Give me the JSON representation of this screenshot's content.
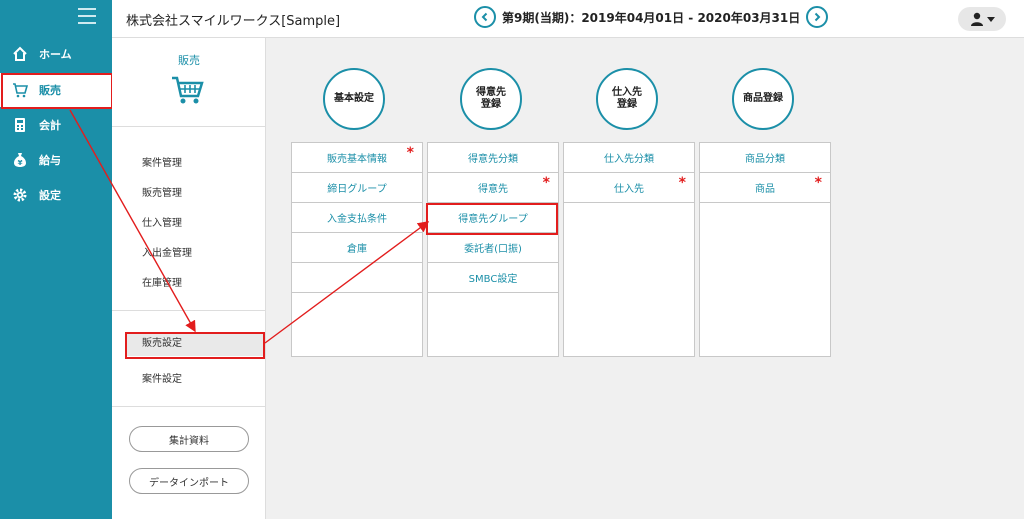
{
  "header": {
    "company": "株式会社スマイルワークス[Sample]",
    "period": "第9期(当期)：2019年04月01日 - 2020年03月31日"
  },
  "nav": {
    "items": [
      {
        "label": "ホーム",
        "icon": "home-icon"
      },
      {
        "label": "販売",
        "icon": "cart-icon"
      },
      {
        "label": "会計",
        "icon": "calculator-icon"
      },
      {
        "label": "給与",
        "icon": "yen-bag-icon"
      },
      {
        "label": "設定",
        "icon": "gear-icon"
      }
    ]
  },
  "subnav": {
    "title": "販売",
    "items": [
      "案件管理",
      "販売管理",
      "仕入管理",
      "入出金管理",
      "在庫管理"
    ],
    "settings": [
      "販売設定",
      "案件設定"
    ],
    "buttons": [
      "集計資料",
      "データインポート"
    ]
  },
  "categories": [
    {
      "title": "基本設定",
      "items": [
        {
          "label": "販売基本情報",
          "required": true
        },
        {
          "label": "締日グループ",
          "required": false
        },
        {
          "label": "入金支払条件",
          "required": false
        },
        {
          "label": "倉庫",
          "required": false
        }
      ]
    },
    {
      "title": "得意先\n登録",
      "items": [
        {
          "label": "得意先分類",
          "required": false
        },
        {
          "label": "得意先",
          "required": true
        },
        {
          "label": "得意先グループ",
          "required": false
        },
        {
          "label": "委託者(口振)",
          "required": false
        },
        {
          "label": "SMBC設定",
          "required": false
        }
      ]
    },
    {
      "title": "仕入先\n登録",
      "items": [
        {
          "label": "仕入先分類",
          "required": false
        },
        {
          "label": "仕入先",
          "required": true
        }
      ]
    },
    {
      "title": "商品登録",
      "items": [
        {
          "label": "商品分類",
          "required": false
        },
        {
          "label": "商品",
          "required": true
        }
      ]
    }
  ],
  "required_mark": "*",
  "colors": {
    "accent": "#1b8fa8",
    "highlight": "#e21d1d"
  }
}
